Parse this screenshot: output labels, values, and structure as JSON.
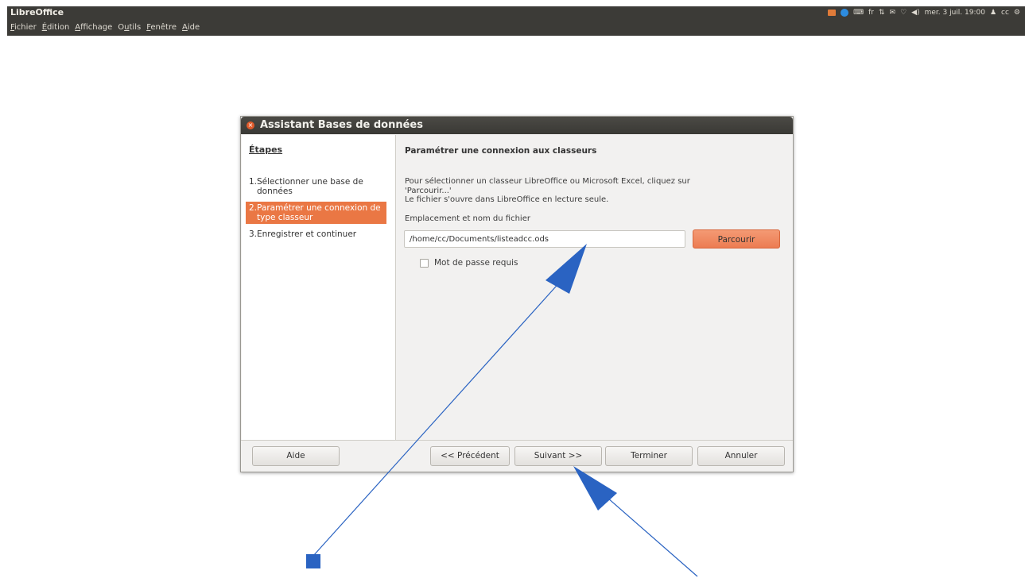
{
  "topbar": {
    "app_title": "LibreOffice",
    "lang": "fr",
    "clock": "mer. 3 juil. 19:00",
    "user": "cc"
  },
  "menubar": {
    "items": [
      {
        "pre": "",
        "ul": "F",
        "post": "ichier"
      },
      {
        "pre": "",
        "ul": "É",
        "post": "dition"
      },
      {
        "pre": "",
        "ul": "A",
        "post": "ffichage"
      },
      {
        "pre": "O",
        "ul": "u",
        "post": "tils"
      },
      {
        "pre": "",
        "ul": "F",
        "post": "enêtre"
      },
      {
        "pre": "",
        "ul": "A",
        "post": "ide"
      }
    ]
  },
  "dialog": {
    "title": "Assistant Bases de données",
    "steps_heading": "Étapes",
    "steps": [
      {
        "label": "1.Sélectionner une base de données",
        "active": false
      },
      {
        "label": "2.Paramétrer une connexion de type classeur",
        "active": true
      },
      {
        "label": "3.Enregistrer et continuer",
        "active": false
      }
    ],
    "content_title": "Paramétrer une connexion aux classeurs",
    "description_lines": [
      "Pour sélectionner un classeur LibreOffice ou Microsoft Excel, cliquez sur",
      "'Parcourir...'",
      "Le fichier s'ouvre dans LibreOffice en lecture seule."
    ],
    "location_label": "Emplacement et nom du fichier",
    "file_path": "/home/cc/Documents/listeadcc.ods",
    "browse_label": "Parcourir",
    "password_label": "Mot de passe requis",
    "password_checked": false,
    "buttons": {
      "help": "Aide",
      "previous": "<< Précédent",
      "next": "Suivant >>",
      "finish": "Terminer",
      "cancel": "Annuler"
    }
  },
  "annotations": {
    "arrow_color": "#2a63c2"
  }
}
